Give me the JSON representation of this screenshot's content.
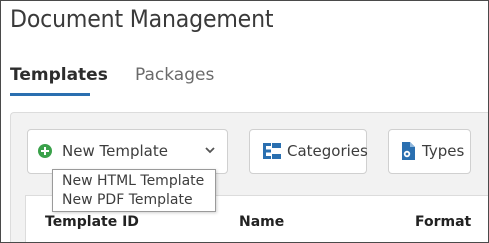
{
  "header": {
    "title": "Document Management"
  },
  "tabs": [
    {
      "label": "Templates",
      "active": true
    },
    {
      "label": "Packages",
      "active": false
    }
  ],
  "toolbar": {
    "new_template": {
      "label": "New Template",
      "icon": "plus-circle-icon",
      "icon_color": "#3aa14a"
    },
    "categories": {
      "label": "Categories",
      "icon": "categories-icon"
    },
    "types": {
      "label": "Types",
      "icon": "types-icon"
    }
  },
  "dropdown": {
    "items": [
      {
        "label": "New HTML Template"
      },
      {
        "label": "New PDF Template"
      }
    ]
  },
  "table": {
    "columns": [
      "Template ID",
      "Name",
      "Format"
    ]
  },
  "colors": {
    "accent": "#2a6fb0",
    "icon_blue": "#2a6fb0",
    "plus_green": "#3aa14a"
  }
}
